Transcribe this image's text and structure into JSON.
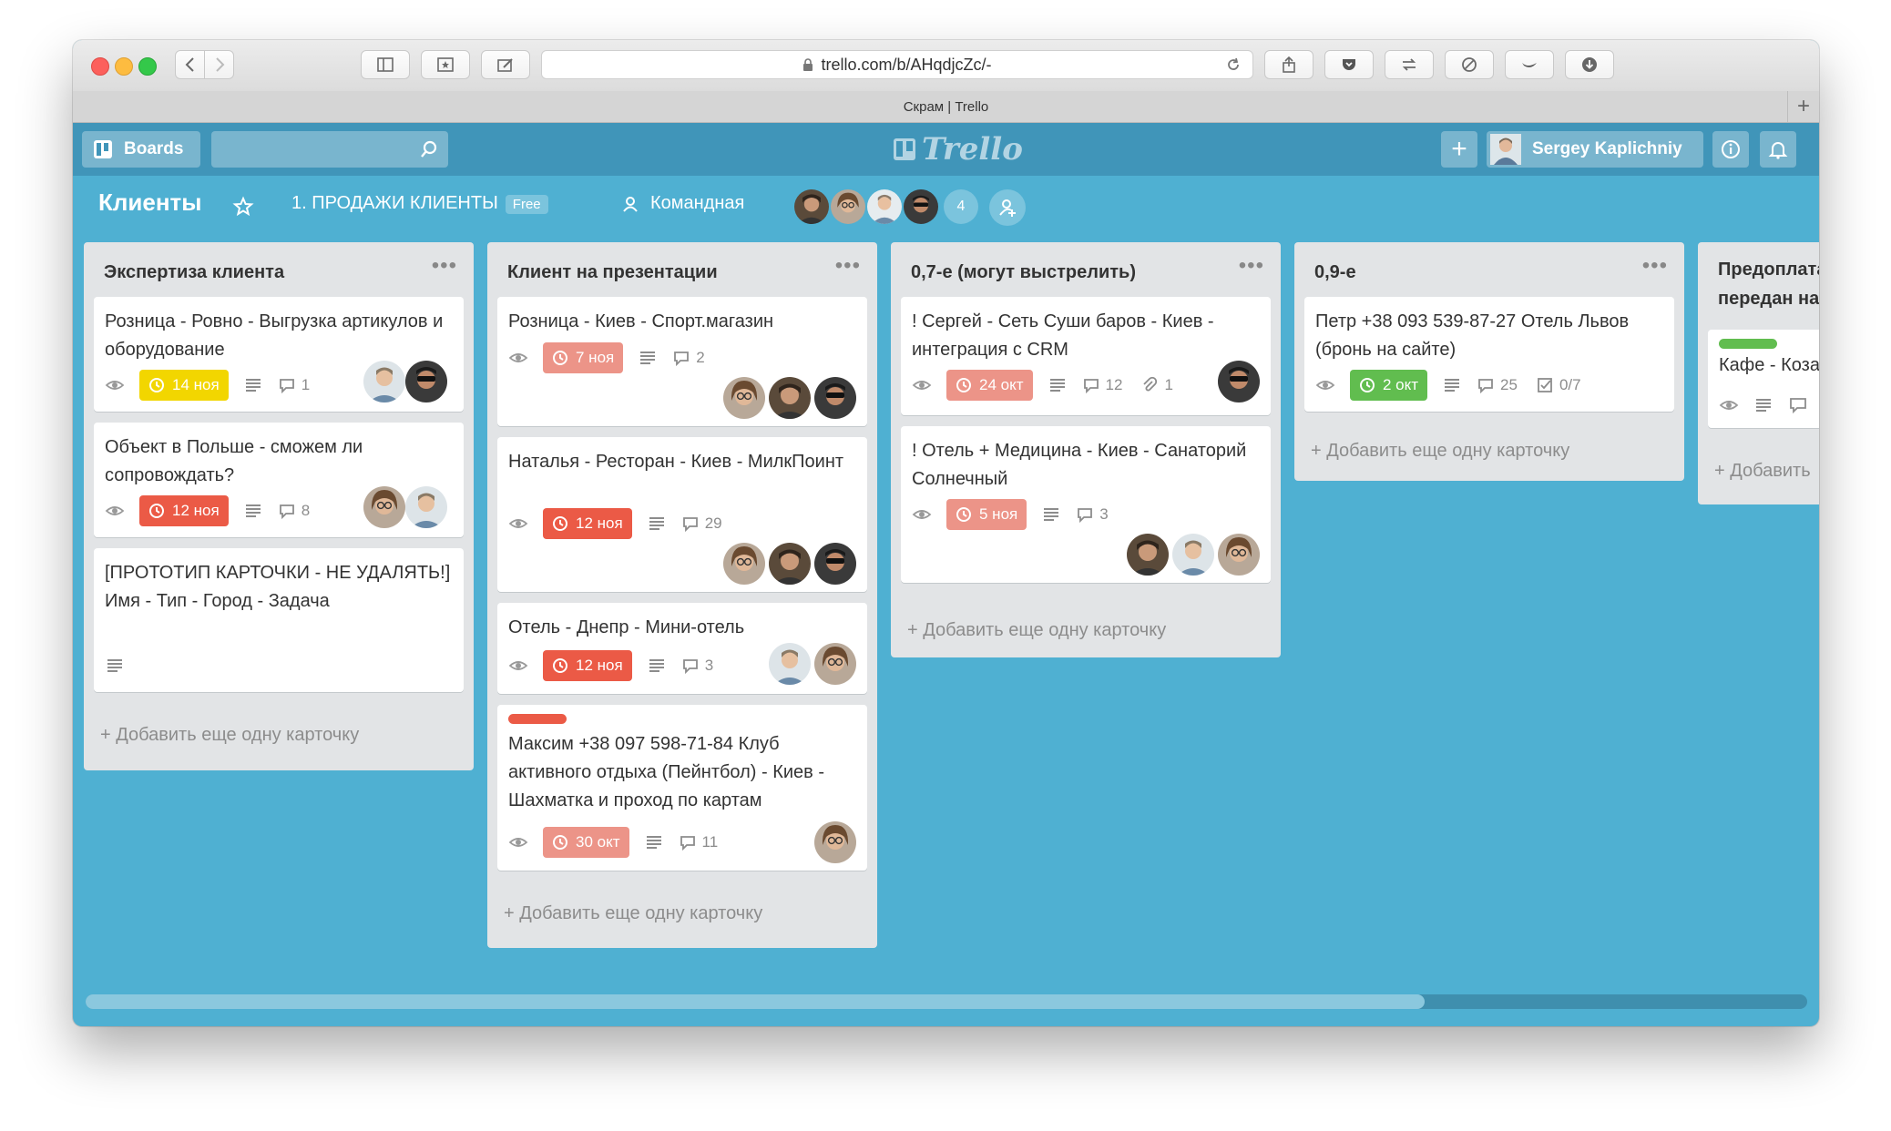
{
  "browser": {
    "url": "trello.com/b/AHqdjcZc/-",
    "tab_title": "Скрам | Trello"
  },
  "header": {
    "boards_label": "Boards",
    "search_placeholder": "",
    "logo_text": "Trello",
    "user_name": "Sergey Kaplichniy"
  },
  "board": {
    "title": "Клиенты",
    "team": "1. ПРОДАЖИ КЛИЕНТЫ",
    "plan": "Free",
    "visibility": "Командная",
    "member_overflow_count": "4"
  },
  "colors": {
    "board_bg": "#4fb0d2",
    "header_bg": "#4095b9",
    "due_overdue": "#eb5a46",
    "due_soon": "#f2d600",
    "due_complete": "#61bd4f",
    "label_red": "#eb5a46",
    "label_green": "#61bd4f"
  },
  "lists": [
    {
      "title": "Экспертиза клиента",
      "add_card": "Добавить еще одну карточку",
      "cards": [
        {
          "title": "Розница - Ровно - Выгрузка артикулов и оборудование",
          "due": "14 ноя",
          "comments": "1"
        },
        {
          "title": "Объект в Польше - сможем ли сопровождать?",
          "due": "12 ноя",
          "comments": "8"
        },
        {
          "title": "[ПРОТОТИП КАРТОЧКИ - НЕ УДАЛЯТЬ!] Имя - Тип - Город - Задача"
        }
      ]
    },
    {
      "title": "Клиент на презентации",
      "add_card": "Добавить еще одну карточку",
      "cards": [
        {
          "title": "Розница - Киев - Спорт.магазин",
          "due": "7 ноя",
          "comments": "2"
        },
        {
          "title": "Наталья - Ресторан - Киев - МилкПоинт",
          "due": "12 ноя",
          "comments": "29"
        },
        {
          "title": "Отель - Днепр - Мини-отель",
          "due": "12 ноя",
          "comments": "3"
        },
        {
          "title": "Максим +38 097 598-71-84 Клуб активного отдыха (Пейнтбол) - Киев - Шахматка и проход по картам",
          "due": "30 окт",
          "comments": "11"
        }
      ]
    },
    {
      "title": "0,7-е (могут выстрелить)",
      "add_card": "Добавить еще одну карточку",
      "cards": [
        {
          "title": "! Сергей - Сеть Суши баров - Киев - интеграция с CRM",
          "due": "24 окт",
          "comments": "12",
          "attachments": "1"
        },
        {
          "title": "! Отель + Медицина - Киев - Санаторий Солнечный",
          "due": "5 ноя",
          "comments": "3"
        }
      ]
    },
    {
      "title": "0,9-е",
      "add_card": "Добавить еще одну карточку",
      "cards": [
        {
          "title": "Петр +38 093 539-87-27 Отель Львов (бронь на сайте)",
          "due": "2 окт",
          "comments": "25",
          "checklist": "0/7"
        }
      ]
    },
    {
      "title": "Предоплата передан на",
      "add_card": "Добавить",
      "cards": [
        {
          "title": "Кафе - Коза"
        }
      ]
    }
  ]
}
